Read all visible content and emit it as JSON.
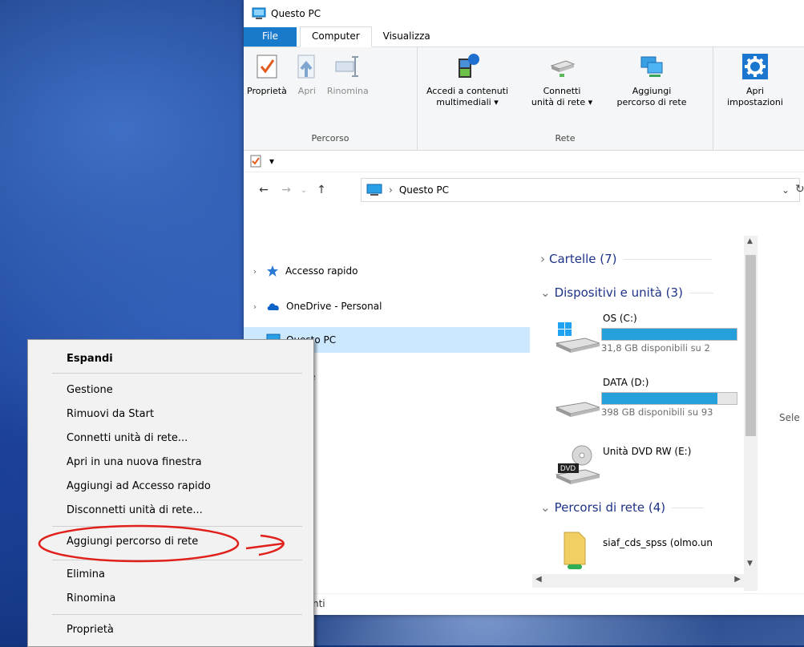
{
  "window": {
    "title": "Questo PC"
  },
  "tabs": [
    {
      "label": "File"
    },
    {
      "label": "Computer"
    },
    {
      "label": "Visualizza"
    }
  ],
  "ribbon": {
    "groups": [
      {
        "label": "Percorso",
        "buttons": [
          {
            "label": "Proprietà",
            "icon": "properties-icon"
          },
          {
            "label": "Apri",
            "icon": "open-icon"
          },
          {
            "label": "Rinomina",
            "icon": "rename-icon"
          }
        ]
      },
      {
        "label": "Rete",
        "buttons": [
          {
            "line1": "Accedi a contenuti",
            "line2": "multimediali ▾",
            "icon": "media-access-icon"
          },
          {
            "line1": "Connetti",
            "line2": "unità di rete ▾",
            "icon": "map-network-drive-icon"
          },
          {
            "line1": "Aggiungi",
            "line2": "percorso di rete",
            "icon": "add-network-location-icon"
          }
        ]
      },
      {
        "label": "",
        "buttons": [
          {
            "line1": "Apri",
            "line2": "impostazioni",
            "icon": "settings-gear-icon"
          }
        ]
      }
    ]
  },
  "address": {
    "path": "Questo PC"
  },
  "nav": {
    "items": [
      {
        "label": "Accesso rapido"
      },
      {
        "label": "OneDrive - Personal"
      },
      {
        "label": "Questo PC"
      },
      {
        "label": "e"
      }
    ]
  },
  "sections": [
    {
      "label": "Cartelle (7)"
    },
    {
      "label": "Dispositivi e unità (3)"
    },
    {
      "label": "Percorsi di rete (4)"
    }
  ],
  "drives": [
    {
      "name": "OS (C:)",
      "free": "31,8 GB disponibili su 2",
      "fill": 1.0
    },
    {
      "name": "DATA (D:)",
      "free": "398 GB disponibili su 93",
      "fill": 0.86
    },
    {
      "name": "Unità DVD RW (E:)"
    }
  ],
  "network": [
    {
      "name": "siaf_cds_spss (olmo.un"
    }
  ],
  "details_hint": "Sele",
  "status_fragment": "nti",
  "context_menu": {
    "items": [
      "Espandi",
      "Gestione",
      "Rimuovi da Start",
      "Connetti unità di rete...",
      "Apri in una nuova finestra",
      "Aggiungi ad Accesso rapido",
      "Disconnetti unità di rete...",
      "Aggiungi percorso di rete",
      "Elimina",
      "Rinomina",
      "Proprietà"
    ]
  },
  "colors": {
    "accent": "#1979ca",
    "drive_bar": "#26a0da",
    "selection": "#cce8ff",
    "annotation": "#e0201b"
  }
}
